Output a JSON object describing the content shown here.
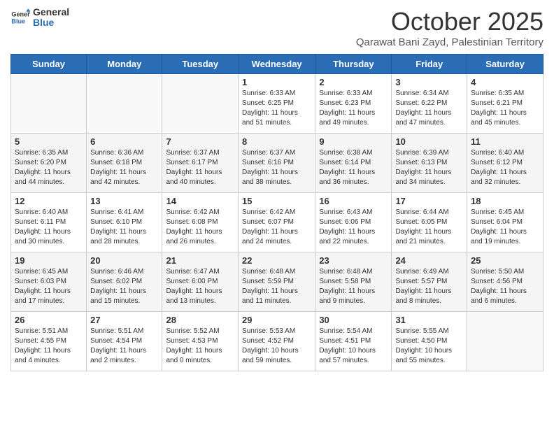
{
  "header": {
    "logo_general": "General",
    "logo_blue": "Blue",
    "month_title": "October 2025",
    "subtitle": "Qarawat Bani Zayd, Palestinian Territory"
  },
  "days_of_week": [
    "Sunday",
    "Monday",
    "Tuesday",
    "Wednesday",
    "Thursday",
    "Friday",
    "Saturday"
  ],
  "weeks": [
    [
      {
        "day": "",
        "info": ""
      },
      {
        "day": "",
        "info": ""
      },
      {
        "day": "",
        "info": ""
      },
      {
        "day": "1",
        "info": "Sunrise: 6:33 AM\nSunset: 6:25 PM\nDaylight: 11 hours and 51 minutes."
      },
      {
        "day": "2",
        "info": "Sunrise: 6:33 AM\nSunset: 6:23 PM\nDaylight: 11 hours and 49 minutes."
      },
      {
        "day": "3",
        "info": "Sunrise: 6:34 AM\nSunset: 6:22 PM\nDaylight: 11 hours and 47 minutes."
      },
      {
        "day": "4",
        "info": "Sunrise: 6:35 AM\nSunset: 6:21 PM\nDaylight: 11 hours and 45 minutes."
      }
    ],
    [
      {
        "day": "5",
        "info": "Sunrise: 6:35 AM\nSunset: 6:20 PM\nDaylight: 11 hours and 44 minutes."
      },
      {
        "day": "6",
        "info": "Sunrise: 6:36 AM\nSunset: 6:18 PM\nDaylight: 11 hours and 42 minutes."
      },
      {
        "day": "7",
        "info": "Sunrise: 6:37 AM\nSunset: 6:17 PM\nDaylight: 11 hours and 40 minutes."
      },
      {
        "day": "8",
        "info": "Sunrise: 6:37 AM\nSunset: 6:16 PM\nDaylight: 11 hours and 38 minutes."
      },
      {
        "day": "9",
        "info": "Sunrise: 6:38 AM\nSunset: 6:14 PM\nDaylight: 11 hours and 36 minutes."
      },
      {
        "day": "10",
        "info": "Sunrise: 6:39 AM\nSunset: 6:13 PM\nDaylight: 11 hours and 34 minutes."
      },
      {
        "day": "11",
        "info": "Sunrise: 6:40 AM\nSunset: 6:12 PM\nDaylight: 11 hours and 32 minutes."
      }
    ],
    [
      {
        "day": "12",
        "info": "Sunrise: 6:40 AM\nSunset: 6:11 PM\nDaylight: 11 hours and 30 minutes."
      },
      {
        "day": "13",
        "info": "Sunrise: 6:41 AM\nSunset: 6:10 PM\nDaylight: 11 hours and 28 minutes."
      },
      {
        "day": "14",
        "info": "Sunrise: 6:42 AM\nSunset: 6:08 PM\nDaylight: 11 hours and 26 minutes."
      },
      {
        "day": "15",
        "info": "Sunrise: 6:42 AM\nSunset: 6:07 PM\nDaylight: 11 hours and 24 minutes."
      },
      {
        "day": "16",
        "info": "Sunrise: 6:43 AM\nSunset: 6:06 PM\nDaylight: 11 hours and 22 minutes."
      },
      {
        "day": "17",
        "info": "Sunrise: 6:44 AM\nSunset: 6:05 PM\nDaylight: 11 hours and 21 minutes."
      },
      {
        "day": "18",
        "info": "Sunrise: 6:45 AM\nSunset: 6:04 PM\nDaylight: 11 hours and 19 minutes."
      }
    ],
    [
      {
        "day": "19",
        "info": "Sunrise: 6:45 AM\nSunset: 6:03 PM\nDaylight: 11 hours and 17 minutes."
      },
      {
        "day": "20",
        "info": "Sunrise: 6:46 AM\nSunset: 6:02 PM\nDaylight: 11 hours and 15 minutes."
      },
      {
        "day": "21",
        "info": "Sunrise: 6:47 AM\nSunset: 6:00 PM\nDaylight: 11 hours and 13 minutes."
      },
      {
        "day": "22",
        "info": "Sunrise: 6:48 AM\nSunset: 5:59 PM\nDaylight: 11 hours and 11 minutes."
      },
      {
        "day": "23",
        "info": "Sunrise: 6:48 AM\nSunset: 5:58 PM\nDaylight: 11 hours and 9 minutes."
      },
      {
        "day": "24",
        "info": "Sunrise: 6:49 AM\nSunset: 5:57 PM\nDaylight: 11 hours and 8 minutes."
      },
      {
        "day": "25",
        "info": "Sunrise: 5:50 AM\nSunset: 4:56 PM\nDaylight: 11 hours and 6 minutes."
      }
    ],
    [
      {
        "day": "26",
        "info": "Sunrise: 5:51 AM\nSunset: 4:55 PM\nDaylight: 11 hours and 4 minutes."
      },
      {
        "day": "27",
        "info": "Sunrise: 5:51 AM\nSunset: 4:54 PM\nDaylight: 11 hours and 2 minutes."
      },
      {
        "day": "28",
        "info": "Sunrise: 5:52 AM\nSunset: 4:53 PM\nDaylight: 11 hours and 0 minutes."
      },
      {
        "day": "29",
        "info": "Sunrise: 5:53 AM\nSunset: 4:52 PM\nDaylight: 10 hours and 59 minutes."
      },
      {
        "day": "30",
        "info": "Sunrise: 5:54 AM\nSunset: 4:51 PM\nDaylight: 10 hours and 57 minutes."
      },
      {
        "day": "31",
        "info": "Sunrise: 5:55 AM\nSunset: 4:50 PM\nDaylight: 10 hours and 55 minutes."
      },
      {
        "day": "",
        "info": ""
      }
    ]
  ]
}
